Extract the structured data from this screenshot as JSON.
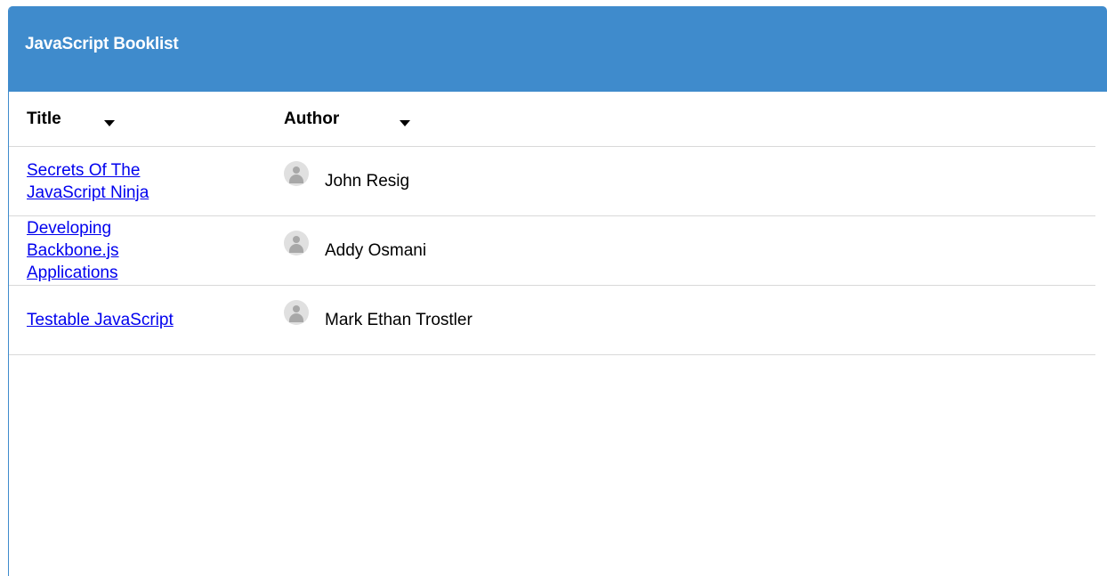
{
  "panel": {
    "title": "JavaScript Booklist"
  },
  "table": {
    "columns": [
      {
        "label": "Title"
      },
      {
        "label": "Author"
      }
    ],
    "rows": [
      {
        "title": "Secrets Of The JavaScript Ninja",
        "author": "John Resig"
      },
      {
        "title": "Developing Backbone.js Applications",
        "author": "Addy Osmani"
      },
      {
        "title": "Testable JavaScript",
        "author": "Mark Ethan Trostler"
      }
    ]
  },
  "icons": {
    "sort": "caret-down-icon",
    "avatar": "user-avatar-icon"
  },
  "colors": {
    "header_bg": "#3f8bcc",
    "link": "#0000ee",
    "divider": "#d9d9d9"
  }
}
